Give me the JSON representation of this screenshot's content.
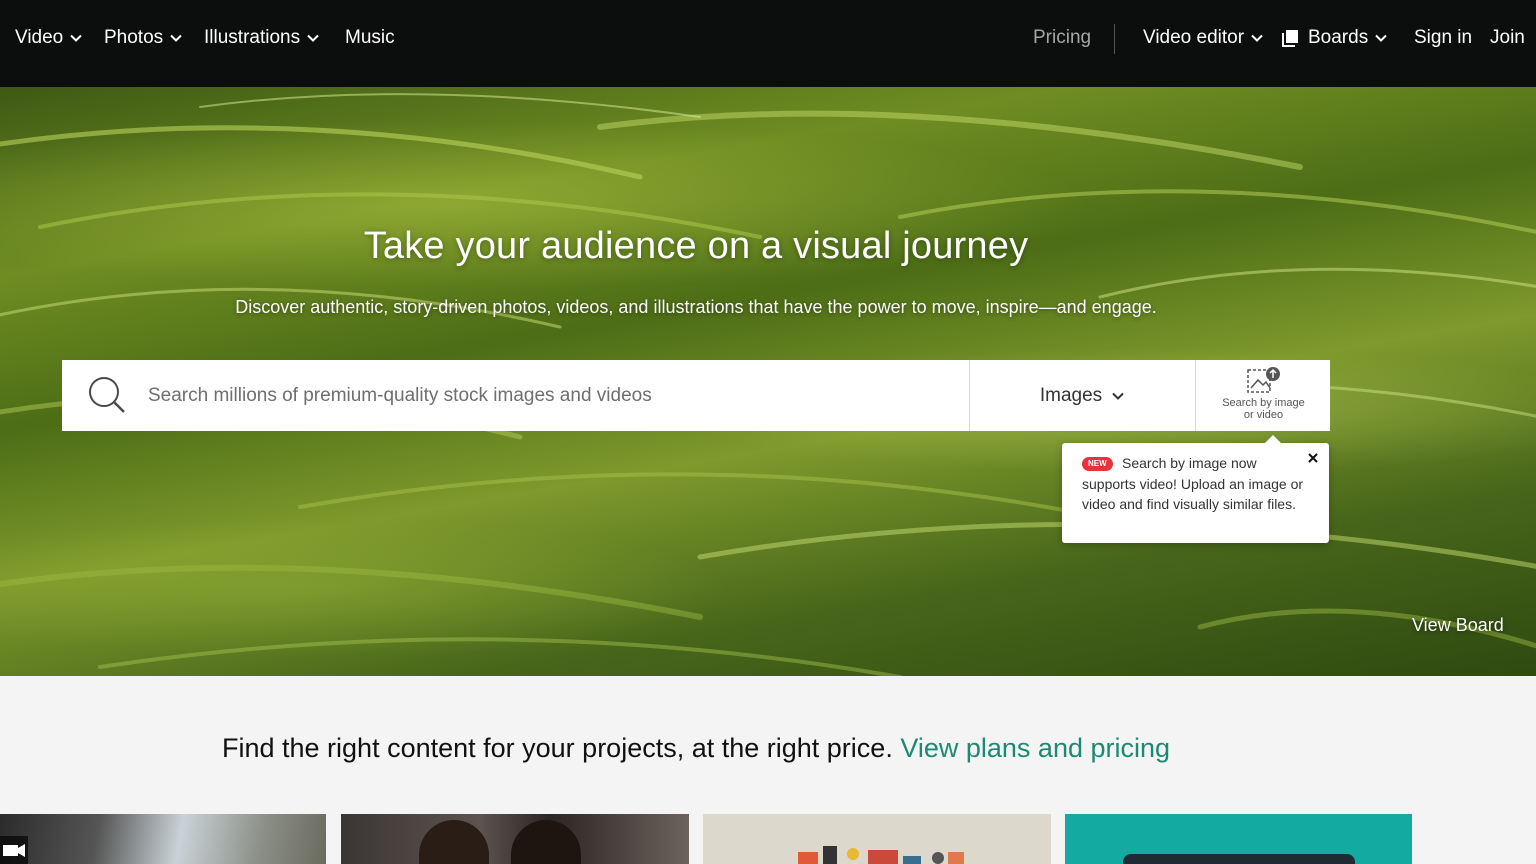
{
  "nav": {
    "left": [
      {
        "label": "Video",
        "has_dropdown": true
      },
      {
        "label": "Photos",
        "has_dropdown": true
      },
      {
        "label": "Illustrations",
        "has_dropdown": true
      },
      {
        "label": "Music",
        "has_dropdown": false
      }
    ],
    "pricing": "Pricing",
    "video_editor": "Video editor",
    "boards": "Boards",
    "sign_in": "Sign in",
    "join": "Join"
  },
  "hero": {
    "title": "Take your audience on a visual journey",
    "subtitle": "Discover authentic, story-driven photos, videos, and illustrations that have the power to move, inspire—and engage.",
    "search": {
      "placeholder": "Search millions of premium-quality stock images and videos",
      "value": "",
      "type_selected": "Images",
      "image_search_label_1": "Search by image",
      "image_search_label_2": "or video"
    },
    "tooltip": {
      "badge": "NEW",
      "text": "Search by image now supports video! Upload an image or video and find visually similar files."
    },
    "view_board": "View Board"
  },
  "promo": {
    "text": "Find the right content for your projects, at the right price.",
    "link": "View plans and pricing"
  },
  "colors": {
    "nav_bg": "#0c0d0d",
    "accent_link": "#1b8a74",
    "badge_red": "#e8333a",
    "teal_card": "#13aaa1"
  },
  "icons": [
    "chevron-down-icon",
    "boards-icon",
    "search-icon",
    "search-by-image-icon",
    "close-icon",
    "video-camera-icon"
  ]
}
